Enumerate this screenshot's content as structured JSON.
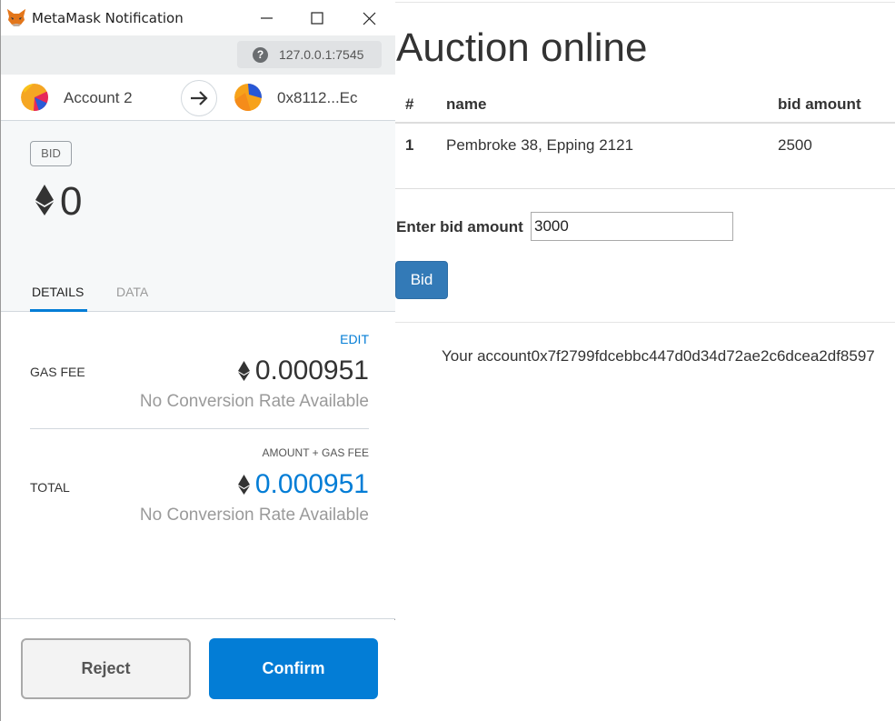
{
  "window": {
    "title": "MetaMask Notification",
    "url": "127.0.0.1:7545"
  },
  "accounts": {
    "from_name": "Account 2",
    "to_address": "0x8112...Ec"
  },
  "summary": {
    "badge": "BID",
    "amount": "0"
  },
  "tabs": [
    "DETAILS",
    "DATA"
  ],
  "details": {
    "edit_label": "EDIT",
    "gas_fee_label": "GAS FEE",
    "gas_fee_value": "0.000951",
    "gas_fee_conversion": "No Conversion Rate Available",
    "total_caption": "AMOUNT + GAS FEE",
    "total_label": "TOTAL",
    "total_value": "0.000951",
    "total_conversion": "No Conversion Rate Available"
  },
  "buttons": {
    "reject": "Reject",
    "confirm": "Confirm"
  },
  "auction": {
    "title": "Auction online",
    "columns": [
      "#",
      "name",
      "bid amount"
    ],
    "rows": [
      {
        "num": "1",
        "name": "Pembroke 38, Epping 2121",
        "bid": "2500"
      }
    ],
    "bid_label": "Enter bid amount",
    "bid_value": "3000",
    "bid_button": "Bid",
    "account_text": "Your account0x7f2799fdcebbc447d0d34d72ae2c6dcea2df8597"
  },
  "colors": {
    "metamask_blue": "#037dd6",
    "bootstrap_primary": "#337ab7"
  }
}
